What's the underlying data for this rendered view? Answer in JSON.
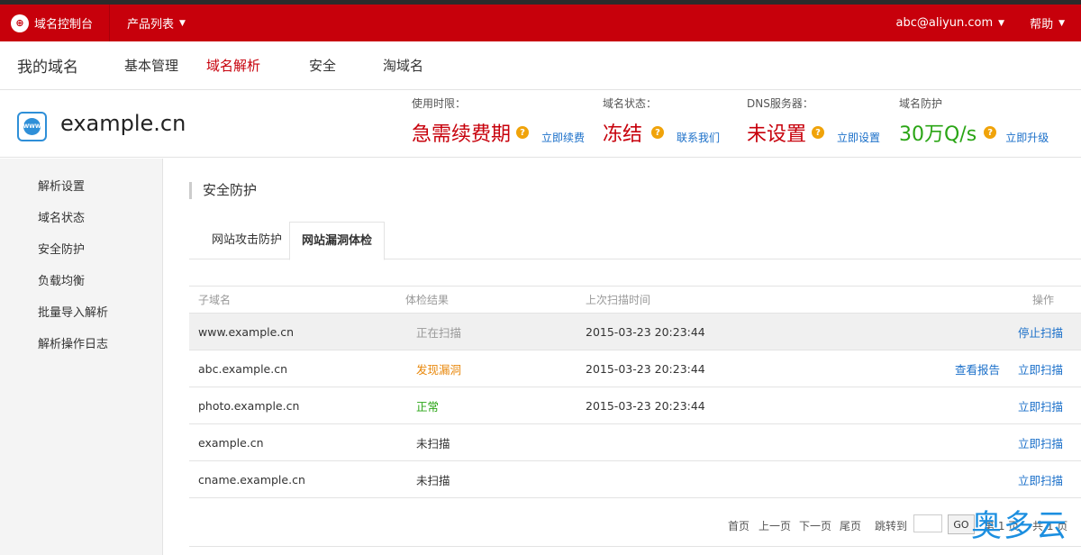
{
  "topbar": {
    "logo_text": "域名控制台",
    "product_list": "产品列表",
    "account": "abc@aliyun.com",
    "help": "帮助"
  },
  "subnav": {
    "title": "我的域名",
    "tabs": [
      "基本管理",
      "域名解析",
      "安全",
      "淘域名"
    ],
    "active_tab": "域名解析"
  },
  "domain": {
    "name": "example.cn",
    "icon_text": "WWW",
    "stats": [
      {
        "label": "使用时限：",
        "value": "急需续费期",
        "link": "立即续费",
        "color": "#c7000b"
      },
      {
        "label": "域名状态：",
        "value": "冻结",
        "link": "联系我们",
        "color": "#c7000b"
      },
      {
        "label": "DNS服务器：",
        "value": "未设置",
        "link": "立即设置",
        "color": "#c7000b"
      },
      {
        "label": "域名防护",
        "value": "30万Q/s",
        "link": "立即升级",
        "color": "#2aa515"
      }
    ]
  },
  "sidebar": {
    "items": [
      "解析设置",
      "域名状态",
      "安全防护",
      "负载均衡",
      "批量导入解析",
      "解析操作日志"
    ]
  },
  "main": {
    "section_title": "安全防护",
    "tabs": [
      "网站攻击防护",
      "网站漏洞体检"
    ],
    "active_tab": "网站漏洞体检",
    "table": {
      "headers": [
        "子域名",
        "体检结果",
        "上次扫描时间",
        "操作"
      ],
      "rows": [
        {
          "subdomain": "www.example.cn",
          "result": "正在扫描",
          "time": "2015-03-23 20:23:44",
          "extra_action": "",
          "action": "停止扫描"
        },
        {
          "subdomain": "abc.example.cn",
          "result": "发现漏洞",
          "time": "2015-03-23 20:23:44",
          "extra_action": "查看报告",
          "action": "立即扫描"
        },
        {
          "subdomain": "photo.example.cn",
          "result": "正常",
          "time": "2015-03-23 20:23:44",
          "extra_action": "",
          "action": "立即扫描"
        },
        {
          "subdomain": "example.cn",
          "result": "未扫描",
          "time": "",
          "extra_action": "",
          "action": "立即扫描"
        },
        {
          "subdomain": "cname.example.cn",
          "result": "未扫描",
          "time": "",
          "extra_action": "",
          "action": "立即扫描"
        }
      ]
    },
    "pager": {
      "first": "首页",
      "prev": "上一页",
      "next": "下一页",
      "last": "尾页",
      "jump": "跳转到",
      "go": "GO",
      "page": "第 1 页",
      "total": "共 1 页"
    }
  },
  "watermark": "奥多云",
  "colors": {
    "brand_red": "#c7000b",
    "link_blue": "#1a6fc9",
    "ok_green": "#2aa515",
    "warn_orange": "#e8870a"
  }
}
